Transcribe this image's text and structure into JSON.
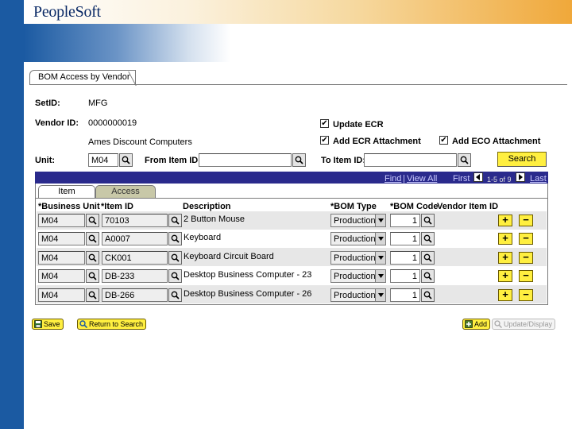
{
  "brand": {
    "logo_text": "PeopleSoft"
  },
  "page": {
    "tab_label": "BOM Access by Vendor"
  },
  "fields": {
    "setid_label": "SetID:",
    "setid_value": "MFG",
    "vendor_id_label": "Vendor ID:",
    "vendor_id_value": "0000000019",
    "vendor_name": "Ames Discount Computers",
    "unit_label": "Unit:",
    "unit_value": "M04",
    "from_item_label": "From Item ID:",
    "from_item_value": "",
    "to_item_label": "To Item ID:",
    "to_item_value": ""
  },
  "checkboxes": {
    "update_ecr": {
      "label": "Update ECR",
      "checked": true,
      "mark": "✔"
    },
    "add_ecr_attachment": {
      "label": "Add ECR Attachment",
      "checked": true,
      "mark": "✔"
    },
    "add_eco_attachment": {
      "label": "Add ECO Attachment",
      "checked": true,
      "mark": "✔"
    }
  },
  "search_button": "Search",
  "grid": {
    "nav": {
      "find": "Find",
      "separator": "|",
      "view_all": "View All",
      "first": "First",
      "range": "1-5 of 9",
      "last": "Last"
    },
    "tabs": [
      "Item",
      "Access"
    ],
    "columns": [
      "*Business Unit",
      "*Item ID",
      "Description",
      "*BOM Type",
      "*BOM Code",
      "Vendor Item ID"
    ],
    "rows": [
      {
        "business_unit": "M04",
        "item_id": "70103",
        "description": "2 Button Mouse",
        "bom_type": "Production",
        "bom_code": "1",
        "vendor_item_id": ""
      },
      {
        "business_unit": "M04",
        "item_id": "A0007",
        "description": "Keyboard",
        "bom_type": "Production",
        "bom_code": "1",
        "vendor_item_id": ""
      },
      {
        "business_unit": "M04",
        "item_id": "CK001",
        "description": "Keyboard Circuit Board",
        "bom_type": "Production",
        "bom_code": "1",
        "vendor_item_id": ""
      },
      {
        "business_unit": "M04",
        "item_id": "DB-233",
        "description": "Desktop Business Computer - 23",
        "bom_type": "Production",
        "bom_code": "1",
        "vendor_item_id": ""
      },
      {
        "business_unit": "M04",
        "item_id": "DB-266",
        "description": "Desktop Business Computer - 26",
        "bom_type": "Production",
        "bom_code": "1",
        "vendor_item_id": ""
      }
    ],
    "add_row_symbol": "+",
    "delete_row_symbol": "−"
  },
  "toolbar": {
    "save": "Save",
    "return_to_search": "Return to Search",
    "add": "Add",
    "update_display": "Update/Display"
  },
  "colors": {
    "brand_blue": "#1b5aa2",
    "grid_header": "#2a2a8c",
    "button_yellow": "#ffef40",
    "banner_orange": "#f0a83a"
  }
}
